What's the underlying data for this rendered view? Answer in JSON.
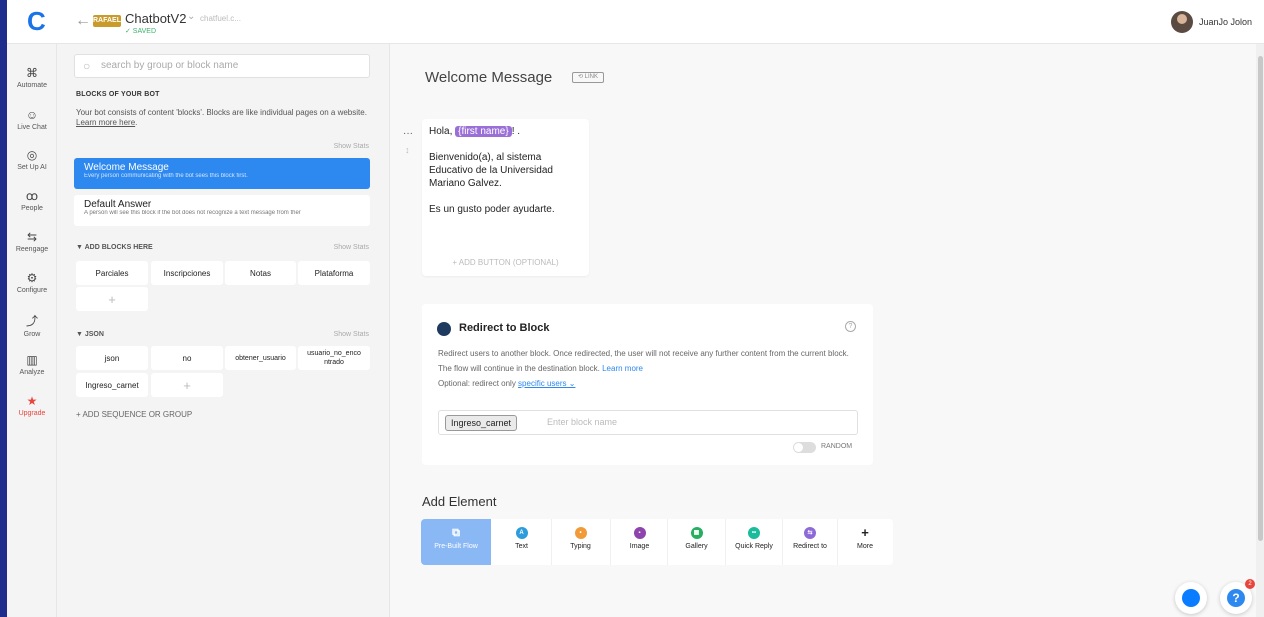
{
  "topbar": {
    "bot_name": "ChatbotV2",
    "bot_url": "chatfuel.c...",
    "saved": "✓ SAVED",
    "bot_logo_text": "RAFAEL",
    "user_name": "JuanJo Jolon"
  },
  "sidenav": [
    {
      "label": "Automate",
      "icon": "⌘"
    },
    {
      "label": "Live Chat",
      "icon": "☺"
    },
    {
      "label": "Set Up AI",
      "icon": "◎"
    },
    {
      "label": "People",
      "icon": "ꝏ"
    },
    {
      "label": "Reengage",
      "icon": "⇆"
    },
    {
      "label": "Configure",
      "icon": "⚙"
    },
    {
      "label": "Grow",
      "icon": "⤴"
    },
    {
      "label": "Analyze",
      "icon": "▥"
    },
    {
      "label": "Upgrade",
      "icon": "★"
    }
  ],
  "blocks_panel": {
    "search_placeholder": "search by group or block name",
    "heading": "BLOCKS OF YOUR BOT",
    "description": "Your bot consists of content 'blocks'. Blocks are like individual pages on a website. ",
    "learn_more": "Learn more here",
    "show_stats": "Show Stats",
    "welcome": {
      "title": "Welcome Message",
      "subtitle": "Every person communicating with the bot sees this block first."
    },
    "default": {
      "title": "Default Answer",
      "subtitle": "A person will see this block if the bot does not recognize a text message from ther"
    },
    "group1": {
      "title": "▼  ADD BLOCKS HERE",
      "chips": [
        "Parciales",
        "Inscripciones",
        "Notas",
        "Plataforma"
      ]
    },
    "group2": {
      "title": "▼  JSON",
      "chips": [
        "json",
        "no",
        "obtener_usuario",
        "usuario_no_enco ntrado",
        "Ingreso_carnet"
      ]
    },
    "add_sequence": "+  ADD SEQUENCE OR GROUP",
    "plus": "+"
  },
  "main": {
    "title": "Welcome Message",
    "link_badge": "⟲ LINK",
    "message": {
      "greeting": "Hola, ",
      "attribute": "{first name}",
      "greeting_end": "! .",
      "line2": "Bienvenido(a), al sistema Educativo de la Universidad Mariano Galvez.",
      "line3": "Es un gusto poder ayudarte.",
      "add_button": "+  ADD BUTTON (OPTIONAL)"
    },
    "redirect": {
      "title": "Redirect to Block",
      "desc": "Redirect users to another block. Once redirected, the user will not receive any further content from the current block. The flow will continue in the destination block. ",
      "learn_more": "Learn more",
      "optional": "Optional: redirect only ",
      "specific_users": "specific users ⌄",
      "tag": "Ingreso_carnet",
      "placeholder": "Enter block name",
      "random": "RANDOM"
    },
    "add_element": {
      "title": "Add Element",
      "items": [
        {
          "label": "Pre-Built Flow",
          "icon": "⧉",
          "color": "#8ab8f5"
        },
        {
          "label": "Text",
          "icon": "A",
          "color": "#2d9cdb"
        },
        {
          "label": "Typing",
          "icon": "•",
          "color": "#f29a38"
        },
        {
          "label": "Image",
          "icon": "▪",
          "color": "#8e44ad"
        },
        {
          "label": "Gallery",
          "icon": "▦",
          "color": "#27ae60"
        },
        {
          "label": "Quick Reply",
          "icon": "••",
          "color": "#1abc9c"
        },
        {
          "label": "Redirect to",
          "icon": "⇆",
          "color": "#8e6ad8"
        },
        {
          "label": "More",
          "icon": "+",
          "color": "#222222"
        }
      ]
    }
  },
  "widgets": {
    "help": "?",
    "notif_count": "2"
  }
}
